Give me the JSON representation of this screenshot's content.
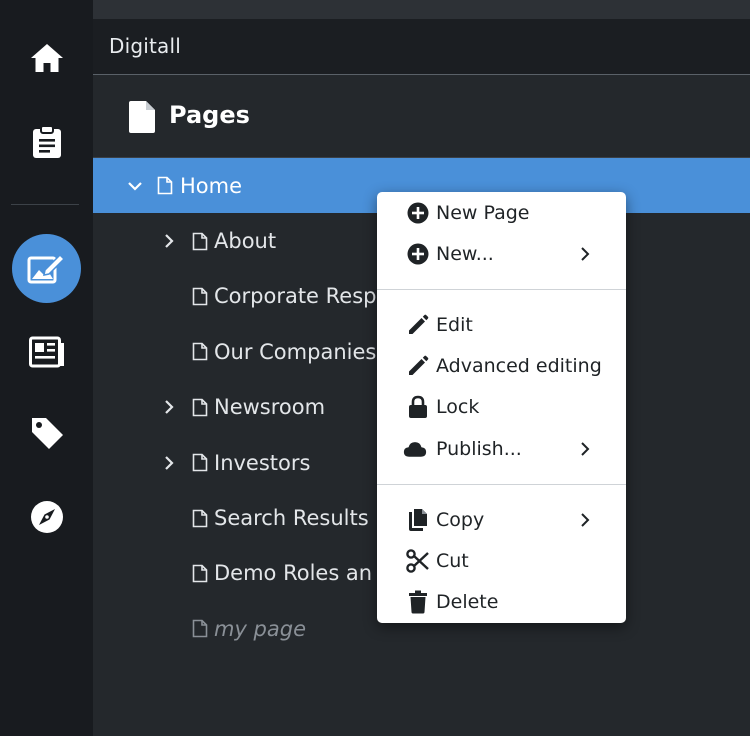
{
  "site": {
    "name": "Digitall"
  },
  "pages_panel": {
    "title": "Pages"
  },
  "rail": {
    "items": [
      {
        "icon": "home-icon"
      },
      {
        "icon": "clipboard-icon"
      },
      {
        "icon": "edit-content-icon",
        "active": true
      },
      {
        "icon": "newspaper-icon"
      },
      {
        "icon": "tag-icon"
      },
      {
        "icon": "compass-icon"
      }
    ]
  },
  "tree": {
    "items": [
      {
        "label": "Home",
        "expanded": true,
        "selected": true
      },
      {
        "label": "About",
        "has_children": true
      },
      {
        "label": "Corporate Resp"
      },
      {
        "label": "Our Companies"
      },
      {
        "label": "Newsroom",
        "has_children": true
      },
      {
        "label": "Investors",
        "has_children": true
      },
      {
        "label": "Search Results"
      },
      {
        "label": "Demo Roles an"
      },
      {
        "label": "my page",
        "unpublished": true
      }
    ]
  },
  "context_menu": {
    "items": [
      {
        "label": "New Page",
        "icon": "plus-circle-icon"
      },
      {
        "label": "New...",
        "icon": "plus-circle-icon",
        "submenu": true
      },
      {
        "label": "Edit",
        "icon": "pencil-icon"
      },
      {
        "label": "Advanced editing",
        "icon": "pencil-icon"
      },
      {
        "label": "Lock",
        "icon": "lock-icon"
      },
      {
        "label": "Publish...",
        "icon": "cloud-icon",
        "submenu": true
      },
      {
        "label": "Copy",
        "icon": "copy-icon",
        "submenu": true
      },
      {
        "label": "Cut",
        "icon": "scissors-icon"
      },
      {
        "label": "Delete",
        "icon": "trash-icon"
      }
    ]
  },
  "colors": {
    "accent": "#4a90d9",
    "rail_bg": "#181b1f",
    "panel_bg": "#24282c",
    "menu_bg": "#ffffff"
  }
}
